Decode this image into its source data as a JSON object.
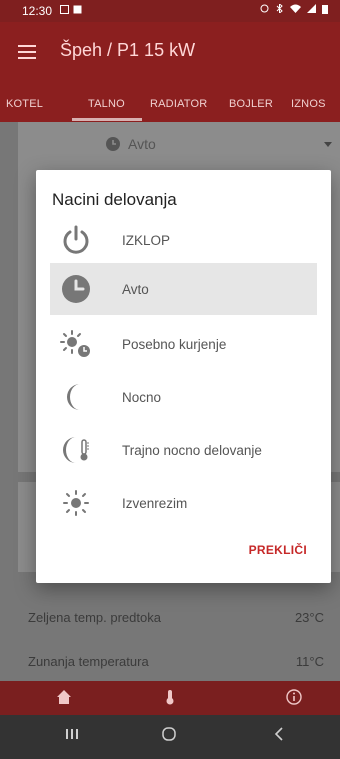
{
  "status_bar": {
    "time": "12:30"
  },
  "app_bar": {
    "title": "Špeh / P1 15 kW"
  },
  "tabs": [
    {
      "label": "KOTEL"
    },
    {
      "label": "TALNO"
    },
    {
      "label": "RADIATOR"
    },
    {
      "label": "BOJLER"
    },
    {
      "label": "IZNOS"
    }
  ],
  "background": {
    "mode_dropdown": "Avto",
    "rows": [
      {
        "label": "Zeljena temp. predtoka",
        "value": "23°C"
      },
      {
        "label": "Zunanja temperatura",
        "value": "11°C"
      }
    ]
  },
  "dialog": {
    "title": "Nacini delovanja",
    "options": [
      {
        "label": "IZKLOP",
        "icon": "power-icon"
      },
      {
        "label": "Avto",
        "icon": "clock-icon",
        "selected": true
      },
      {
        "label": "Posebno kurjenje",
        "icon": "sun-timer-icon"
      },
      {
        "label": "Nocno",
        "icon": "moon-icon"
      },
      {
        "label": "Trajno nocno delovanje",
        "icon": "moon-thermometer-icon"
      },
      {
        "label": "Izvenrezim",
        "icon": "sun-icon"
      }
    ],
    "cancel_label": "PREKLIČI"
  },
  "colors": {
    "brand": "#8b1f1f",
    "accent": "#c62828"
  }
}
